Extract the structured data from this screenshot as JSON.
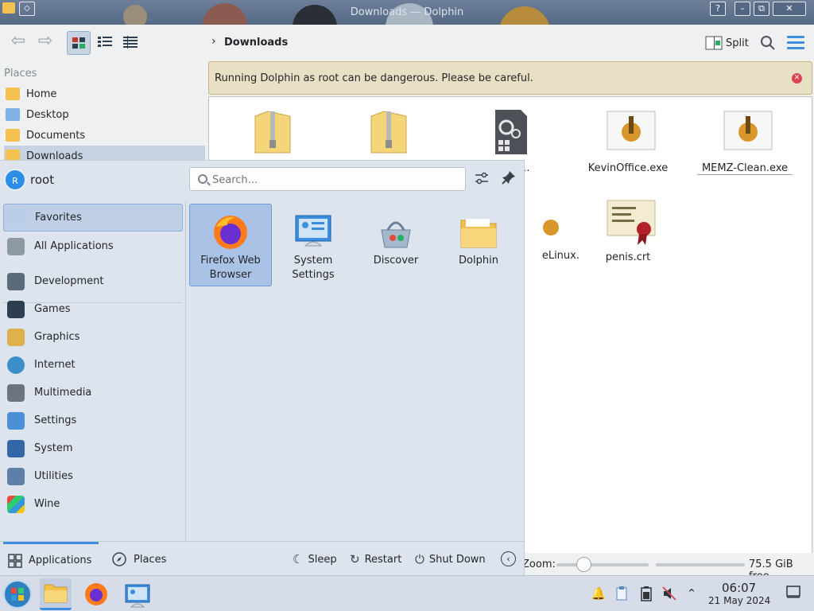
{
  "window": {
    "title": "Downloads — Dolphin",
    "buttons": [
      "?",
      "–",
      "⧉",
      "✕"
    ]
  },
  "toolbar": {
    "breadcrumb": "Downloads",
    "split_label": "Split"
  },
  "places": {
    "header": "Places",
    "items": [
      {
        "label": "Home",
        "icon": "home-folder-icon"
      },
      {
        "label": "Desktop",
        "icon": "desktop-folder-icon"
      },
      {
        "label": "Documents",
        "icon": "documents-folder-icon"
      },
      {
        "label": "Downloads",
        "icon": "downloads-folder-icon",
        "selected": true
      }
    ]
  },
  "warning": {
    "text": "Running Dolphin as root can be dangerous. Please be careful."
  },
  "files": [
    {
      "name": "",
      "icon": "zip-folder-icon"
    },
    {
      "name": "",
      "icon": "zip-folder-icon"
    },
    {
      "name": "etup-1.",
      "icon": "executable-gear-icon"
    },
    {
      "name": "KevinOffice.exe",
      "icon": "wine-exe-icon"
    },
    {
      "name": "MEMZ-Clean.exe",
      "icon": "wine-exe-icon"
    },
    {
      "name": "eLinux.",
      "icon": "wine-exe-icon"
    },
    {
      "name": "penis.crt",
      "icon": "certificate-icon"
    }
  ],
  "status": {
    "zoom_label": "Zoom:",
    "free_space": "75.5 GiB free",
    "zoom_level": 0.3
  },
  "launcher": {
    "user": {
      "avatar_letter": "R",
      "name": "root"
    },
    "search": {
      "placeholder": "Search..."
    },
    "categories": [
      {
        "label": "Favorites",
        "icon": "favorites-icon",
        "selected": true
      },
      {
        "label": "All Applications",
        "icon": "all-applications-icon"
      },
      {
        "label": "Development",
        "icon": "development-icon"
      },
      {
        "label": "Games",
        "icon": "games-icon"
      },
      {
        "label": "Graphics",
        "icon": "graphics-icon"
      },
      {
        "label": "Internet",
        "icon": "internet-icon"
      },
      {
        "label": "Multimedia",
        "icon": "multimedia-icon"
      },
      {
        "label": "Settings",
        "icon": "settings-icon"
      },
      {
        "label": "System",
        "icon": "system-icon"
      },
      {
        "label": "Utilities",
        "icon": "utilities-icon"
      },
      {
        "label": "Wine",
        "icon": "wine-icon"
      }
    ],
    "favorites": [
      {
        "label": "Firefox Web Browser",
        "icon": "firefox-icon",
        "selected": true
      },
      {
        "label": "System Settings",
        "icon": "system-settings-icon"
      },
      {
        "label": "Discover",
        "icon": "discover-icon"
      },
      {
        "label": "Dolphin",
        "icon": "dolphin-folder-icon"
      }
    ],
    "footer": {
      "applications": "Applications",
      "places": "Places",
      "sleep": "Sleep",
      "restart": "Restart",
      "shutdown": "Shut Down"
    }
  },
  "taskbar": {
    "time": "06:07",
    "date": "21 May 2024"
  },
  "colors": {
    "accent": "#3d8ee0",
    "warning_bg": "#e8e0c4",
    "close_red": "#da4453"
  }
}
